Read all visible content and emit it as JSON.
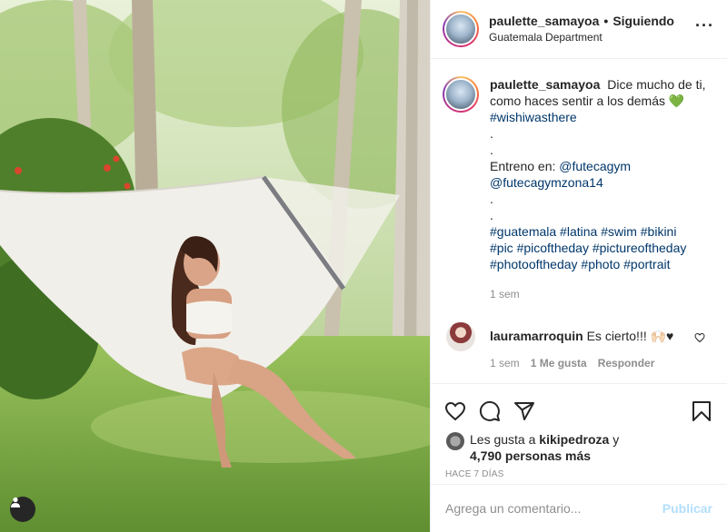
{
  "post": {
    "username": "paulette_samayoa",
    "follow_status": "Siguiendo",
    "location": "Guatemala Department",
    "more_icon": "more-horizontal-icon"
  },
  "caption": {
    "username": "paulette_samayoa",
    "text_line1": "Dice mucho de ti,",
    "text_line2": "como haces sentir a los demás",
    "emoji": "💚",
    "hashtag1": "#wishiwasthere",
    "dot": ".",
    "training_label": "Entreno en:",
    "mention1": "@futecagym",
    "mention2": "@futecagymzona14",
    "tags_line1": "#guatemala #latina #swim #bikini",
    "tags_line2": "#pic #picoftheday #pictureoftheday",
    "tags_line3": "#photooftheday #photo #portrait",
    "time": "1 sem"
  },
  "comment": {
    "username": "lauramarroquin",
    "text": "Es cierto!!! 🙌🏻♥",
    "time": "1 sem",
    "likes": "1 Me gusta",
    "reply": "Responder"
  },
  "likes": {
    "prefix": "Les gusta a",
    "user": "kikipedroza",
    "suffix": "y",
    "count": "4,790 personas más"
  },
  "date": "HACE 7 DÍAS",
  "add_comment": {
    "placeholder": "Agrega un comentario...",
    "publish": "Publicar"
  },
  "colors": {
    "link": "#00376b",
    "publish_disabled": "#b2dffc",
    "muted": "#8e8e8e"
  }
}
